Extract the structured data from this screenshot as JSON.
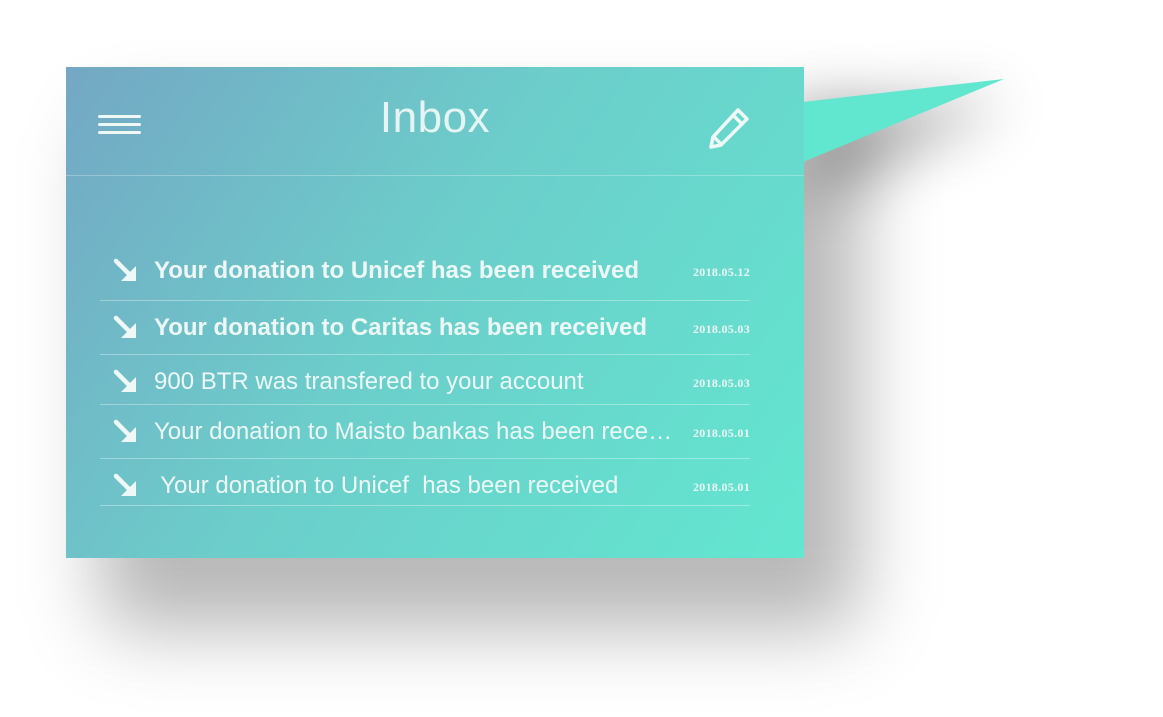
{
  "header": {
    "title": "Inbox",
    "menu_icon": "hamburger-menu-icon",
    "edit_icon": "pencil-icon"
  },
  "messages": [
    {
      "subject": "Your donation to Unicef has been received",
      "date": "2018.05.12",
      "unread": true,
      "icon": "arrow-down-right-icon"
    },
    {
      "subject": "Your donation to Caritas has been received",
      "date": "2018.05.03",
      "unread": true,
      "icon": "arrow-down-right-icon"
    },
    {
      "subject": "900 BTR was transfered to your account",
      "date": "2018.05.03",
      "unread": false,
      "icon": "arrow-down-right-icon"
    },
    {
      "subject": "Your donation to Maisto bankas has been received",
      "date": "2018.05.01",
      "unread": false,
      "icon": "arrow-down-right-icon"
    },
    {
      "subject": " Your donation to Unicef  has been received",
      "date": "2018.05.01",
      "unread": false,
      "icon": "arrow-down-right-icon"
    }
  ],
  "colors": {
    "gradient_start": "#74a7c4",
    "gradient_end": "#62e7d0",
    "text": "#edf8f6"
  }
}
